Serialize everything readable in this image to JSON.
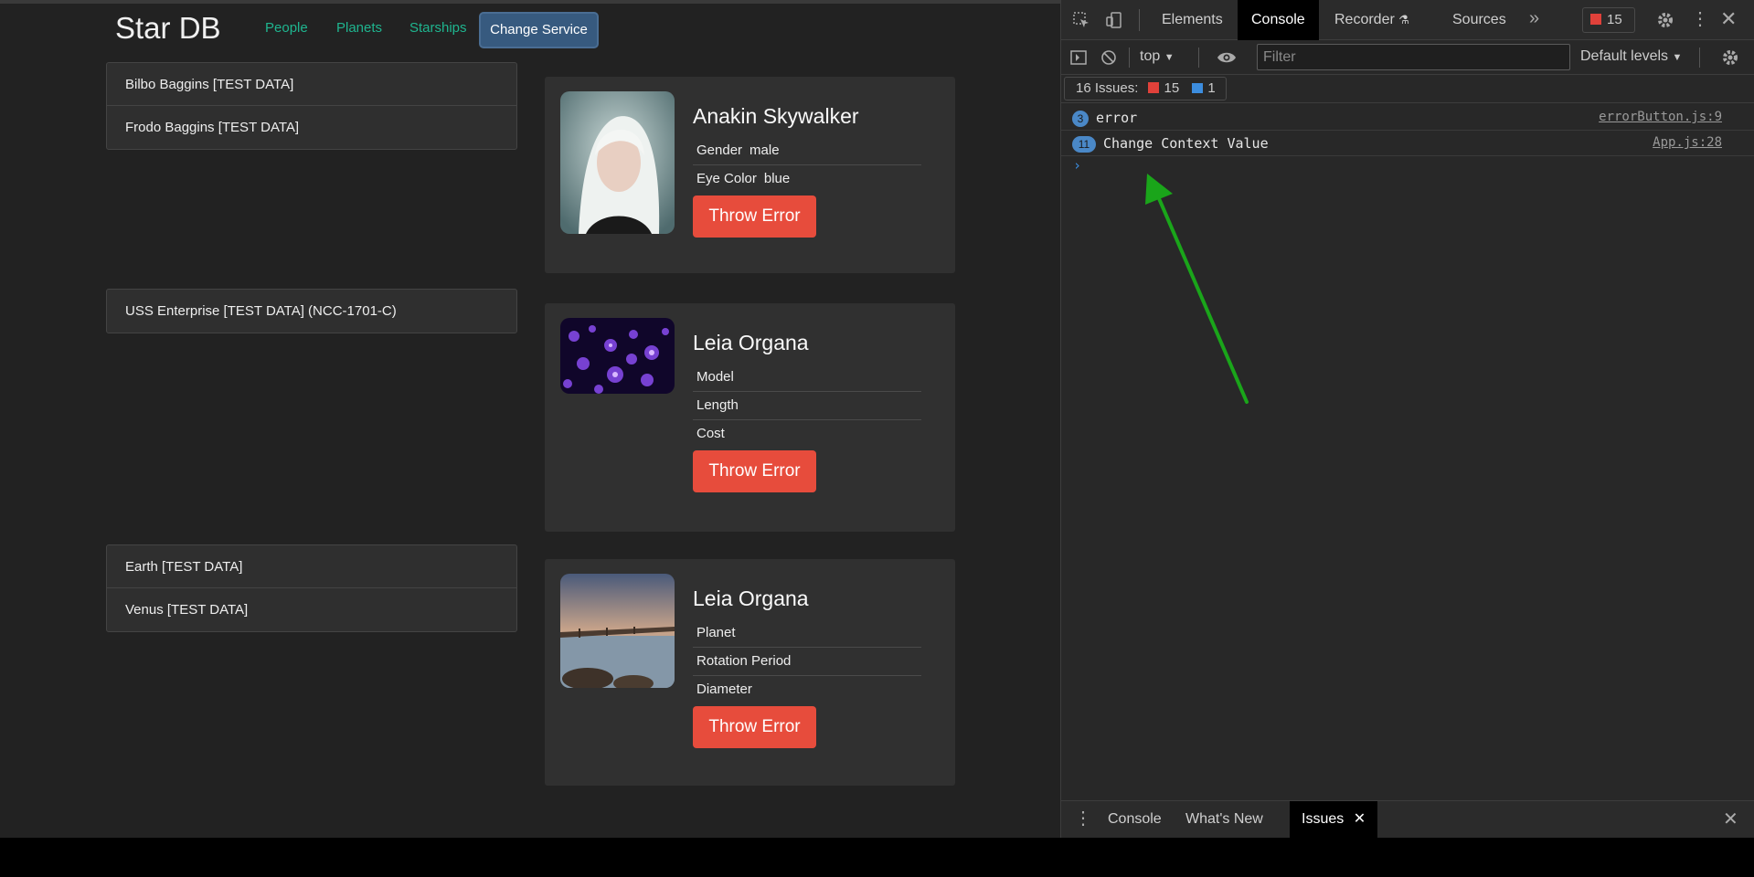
{
  "app": {
    "brand": "Star DB",
    "nav": [
      "People",
      "Planets",
      "Starships"
    ],
    "change_service": "Change Service"
  },
  "people_list": [
    "Bilbo Baggins [TEST DATA]",
    "Frodo Baggins [TEST DATA]"
  ],
  "starships_list": [
    "USS Enterprise [TEST DATA] (NCC-1701-C)"
  ],
  "planets_list": [
    "Earth [TEST DATA]",
    "Venus [TEST DATA]"
  ],
  "person_card": {
    "title": "Anakin Skywalker",
    "props": [
      {
        "label": "Gender",
        "value": "male"
      },
      {
        "label": "Eye Color",
        "value": "blue"
      }
    ],
    "button": "Throw Error"
  },
  "starship_card": {
    "title": "Leia Organa",
    "props": [
      {
        "label": "Model",
        "value": ""
      },
      {
        "label": "Length",
        "value": ""
      },
      {
        "label": "Cost",
        "value": ""
      }
    ],
    "button": "Throw Error"
  },
  "planet_card": {
    "title": "Leia Organa",
    "props": [
      {
        "label": "Planet",
        "value": ""
      },
      {
        "label": "Rotation Period",
        "value": ""
      },
      {
        "label": "Diameter",
        "value": ""
      }
    ],
    "button": "Throw Error"
  },
  "devtools": {
    "tabs": [
      "Elements",
      "Console",
      "Recorder",
      "Sources"
    ],
    "error_count": "15",
    "context": "top",
    "filter_placeholder": "Filter",
    "levels": "Default levels",
    "issues_label": "16 Issues:",
    "issues_errors": "15",
    "issues_info": "1",
    "logs": [
      {
        "count": "3",
        "message": "error",
        "source": "errorButton.js:9"
      },
      {
        "count": "11",
        "message": "Change Context Value",
        "source": "App.js:28"
      }
    ],
    "drawer_tabs": [
      "Console",
      "What's New",
      "Issues"
    ]
  },
  "colors": {
    "accent_nav": "#1fb58f",
    "button_danger": "#e74c3c",
    "button_primary": "#375a7f",
    "annotation_arrow": "#1aa51a"
  }
}
